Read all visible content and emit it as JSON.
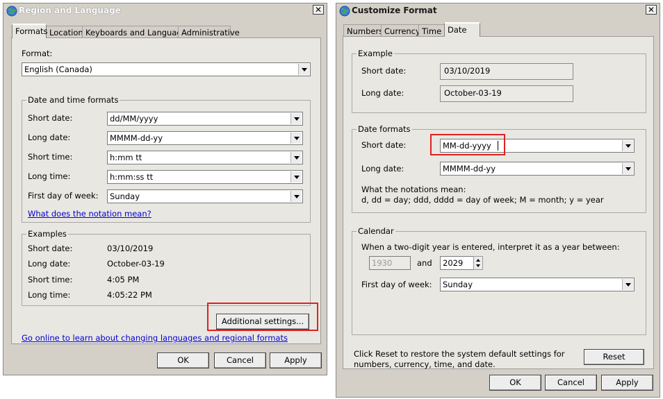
{
  "left_window": {
    "title": "Region and Language",
    "tabs": [
      "Formats",
      "Location",
      "Keyboards and Languages",
      "Administrative"
    ],
    "format_label": "Format:",
    "format_value": "English (Canada)",
    "datetime_group": "Date and time formats",
    "rows": [
      {
        "label": "Short date:",
        "value": "dd/MM/yyyy"
      },
      {
        "label": "Long date:",
        "value": "MMMM-dd-yy"
      },
      {
        "label": "Short time:",
        "value": "h:mm tt"
      },
      {
        "label": "Long time:",
        "value": "h:mm:ss tt"
      },
      {
        "label": "First day of week:",
        "value": "Sunday"
      }
    ],
    "notation_link": "What does the notation mean?",
    "examples_group": "Examples",
    "examples": [
      {
        "label": "Short date:",
        "value": "03/10/2019"
      },
      {
        "label": "Long date:",
        "value": "October-03-19"
      },
      {
        "label": "Short time:",
        "value": "4:05 PM"
      },
      {
        "label": "Long time:",
        "value": "4:05:22 PM"
      }
    ],
    "additional_button": "Additional settings...",
    "online_link": "Go online to learn about changing languages and regional formats",
    "ok": "OK",
    "cancel": "Cancel",
    "apply": "Apply"
  },
  "right_window": {
    "title": "Customize Format",
    "tabs": [
      "Numbers",
      "Currency",
      "Time",
      "Date"
    ],
    "example_group": "Example",
    "example_short_label": "Short date:",
    "example_short_value": "03/10/2019",
    "example_long_label": "Long date:",
    "example_long_value": "October-03-19",
    "formats_group": "Date formats",
    "short_label": "Short date:",
    "short_value": "MM-dd-yyyy",
    "long_label": "Long date:",
    "long_value": "MMMM-dd-yy",
    "notation_title": "What the notations mean:",
    "notation_text": "d, dd = day;  ddd, dddd = day of week;  M = month;  y = year",
    "calendar_group": "Calendar",
    "calendar_text": "When a two-digit year is entered, interpret it as a year between:",
    "year_from": "1930",
    "and_label": "and",
    "year_to": "2029",
    "first_day_label": "First day of week:",
    "first_day_value": "Sunday",
    "reset_text_1": "Click Reset to restore the system default settings for",
    "reset_text_2": "numbers, currency, time, and date.",
    "reset": "Reset",
    "ok": "OK",
    "cancel": "Cancel",
    "apply": "Apply"
  },
  "colors": {
    "highlight": "#e02020",
    "link": "#0000cc",
    "dialog_bg": "#d4d0c8"
  }
}
